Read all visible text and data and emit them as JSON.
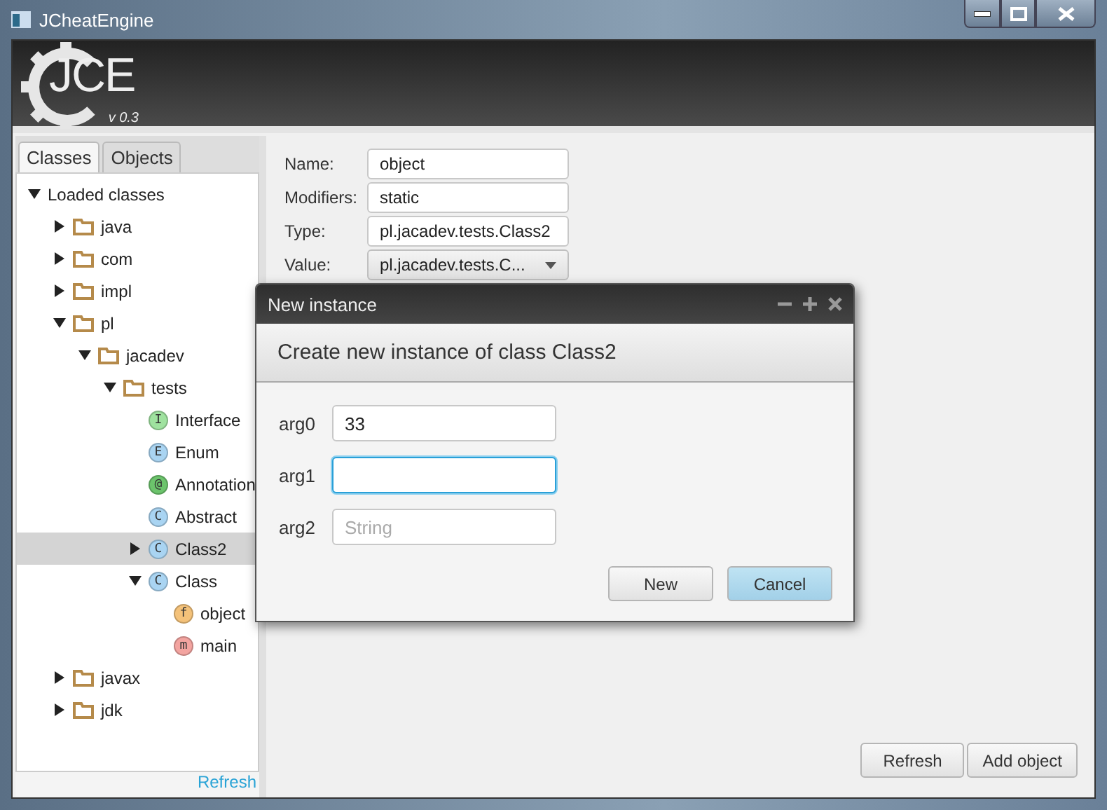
{
  "window": {
    "title": "JCheatEngine"
  },
  "logo": {
    "text": "JCE",
    "version": "v 0.3"
  },
  "tabs": [
    {
      "label": "Classes",
      "selected": true
    },
    {
      "label": "Objects",
      "selected": false
    }
  ],
  "tree": [
    {
      "label": "Loaded classes",
      "expanded": true,
      "selected": false,
      "children": [
        {
          "label": "java",
          "kind": "package",
          "expanded": false,
          "selected": false
        },
        {
          "label": "com",
          "kind": "package",
          "expanded": false,
          "selected": false
        },
        {
          "label": "impl",
          "kind": "package",
          "expanded": false,
          "selected": false
        },
        {
          "label": "pl",
          "kind": "package",
          "expanded": true,
          "selected": false,
          "children": [
            {
              "label": "jacadev",
              "kind": "package",
              "expanded": true,
              "selected": false,
              "children": [
                {
                  "label": "tests",
                  "kind": "package",
                  "expanded": true,
                  "selected": false,
                  "children": [
                    {
                      "label": "Interface",
                      "kind": "interface",
                      "badge": "I",
                      "selected": false
                    },
                    {
                      "label": "Enum",
                      "kind": "enum",
                      "badge": "E",
                      "selected": false
                    },
                    {
                      "label": "Annotation",
                      "kind": "annotation",
                      "badge": "@",
                      "selected": false
                    },
                    {
                      "label": "Abstract",
                      "kind": "class",
                      "badge": "C",
                      "selected": false
                    },
                    {
                      "label": "Class2",
                      "kind": "class",
                      "badge": "C",
                      "expanded": false,
                      "selected": true
                    },
                    {
                      "label": "Class",
                      "kind": "class",
                      "badge": "C",
                      "expanded": true,
                      "selected": false,
                      "children": [
                        {
                          "label": "object",
                          "kind": "field",
                          "badge": "f",
                          "selected": false
                        },
                        {
                          "label": "main",
                          "kind": "method",
                          "badge": "m",
                          "selected": false
                        }
                      ]
                    }
                  ]
                }
              ]
            }
          ]
        },
        {
          "label": "javax",
          "kind": "package",
          "expanded": false,
          "selected": false
        },
        {
          "label": "jdk",
          "kind": "package",
          "expanded": false,
          "selected": false
        }
      ]
    }
  ],
  "tree_footer": {
    "link": "Refresh"
  },
  "details": [
    {
      "label": "Name:",
      "value": "object",
      "kind": "text"
    },
    {
      "label": "Modifiers:",
      "value": "static",
      "kind": "text"
    },
    {
      "label": "Type:",
      "value": "pl.jacadev.tests.Class2",
      "kind": "text"
    },
    {
      "label": "Value:",
      "value": "pl.jacadev.tests.C...",
      "kind": "combo"
    }
  ],
  "actions": [
    {
      "label": "Refresh"
    },
    {
      "label": "Add object"
    }
  ],
  "dialog": {
    "title": "New instance",
    "header": "Create new instance of class Class2",
    "args": [
      {
        "label": "arg0",
        "value": "33",
        "focused": false
      },
      {
        "label": "arg1",
        "focused": true
      },
      {
        "label": "arg2",
        "placeholder": "String",
        "focused": false
      }
    ],
    "buttons": [
      {
        "label": "New",
        "default": false
      },
      {
        "label": "Cancel",
        "default": true
      }
    ]
  }
}
